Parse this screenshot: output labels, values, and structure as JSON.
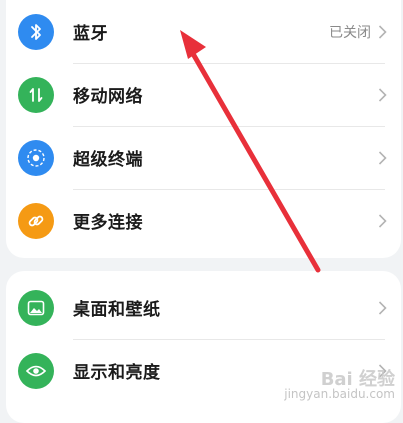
{
  "colors": {
    "bluetooth": "#2f8bf0",
    "mobile_network": "#34b35a",
    "super_device": "#2f8bf0",
    "more_connections": "#f59a14",
    "wallpaper": "#34b35a",
    "display": "#34b35a",
    "annotation_arrow": "#e8303a"
  },
  "group1": {
    "items": [
      {
        "label": "蓝牙",
        "value": "已关闭",
        "icon": "bluetooth-icon"
      },
      {
        "label": "移动网络",
        "value": "",
        "icon": "mobile-data-icon"
      },
      {
        "label": "超级终端",
        "value": "",
        "icon": "super-device-icon"
      },
      {
        "label": "更多连接",
        "value": "",
        "icon": "link-icon"
      }
    ]
  },
  "group2": {
    "items": [
      {
        "label": "桌面和壁纸",
        "value": "",
        "icon": "image-icon"
      },
      {
        "label": "显示和亮度",
        "value": "",
        "icon": "eye-icon"
      }
    ]
  },
  "watermark": {
    "line1": "Bai 经验",
    "line2": "jingyan.baidu.com"
  }
}
